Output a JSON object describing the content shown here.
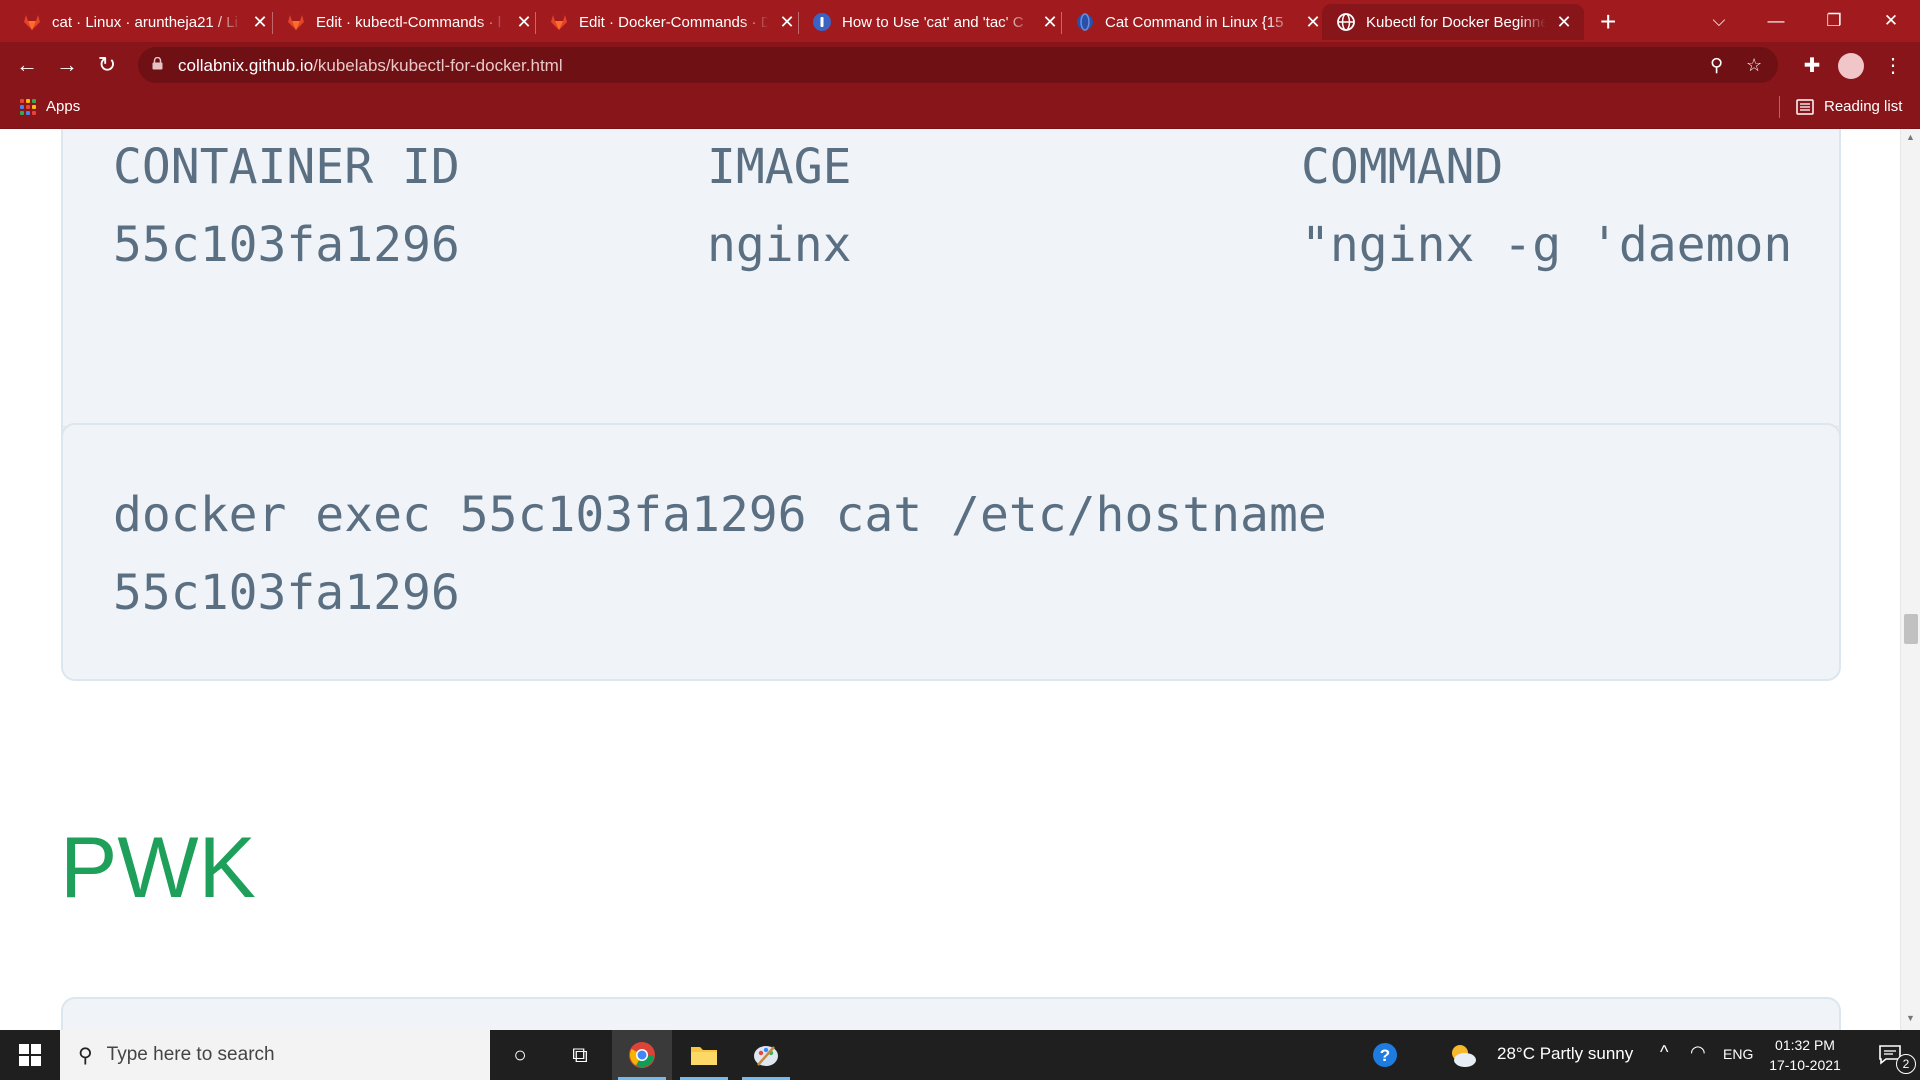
{
  "browser": {
    "tabs": [
      {
        "title": "cat · Linux · aruntheja21 / Li",
        "favicon": "gitlab-fox-icon"
      },
      {
        "title": "Edit · kubectl-Commands · l",
        "favicon": "gitlab-fox-icon"
      },
      {
        "title": "Edit · Docker-Commands · D",
        "favicon": "gitlab-fox-icon"
      },
      {
        "title": "How to Use 'cat' and 'tac' C",
        "favicon": "site-shield-icon"
      },
      {
        "title": "Cat Command in Linux {15",
        "favicon": "site-globe-blue-icon"
      },
      {
        "title": "Kubectl for Docker Beginne",
        "favicon": "globe-icon",
        "active": true
      }
    ],
    "close_glyph": "✕",
    "new_tab_glyph": "+",
    "url_host": "collabnix.github.io",
    "url_path": "/kubelabs/kubectl-for-docker.html",
    "bookmarks": {
      "apps_label": "Apps",
      "reading_list_label": "Reading list"
    },
    "accent": "#871519"
  },
  "page": {
    "docker_ps": {
      "headers": [
        "CONTAINER ID",
        "IMAGE",
        "COMMAND"
      ],
      "row": [
        "55c103fa1296",
        "nginx",
        "\"nginx -g 'daemon"
      ]
    },
    "exec_block": {
      "line1": "docker exec 55c103fa1296 cat /etc/hostname",
      "line2": "55c103fa1296"
    },
    "section_heading": "PWK",
    "heading_color": "#1ea05a"
  },
  "taskbar": {
    "search_placeholder": "Type here to search",
    "weather": "28°C  Partly sunny",
    "language": "ENG",
    "time": "01:32 PM",
    "date": "17-10-2021",
    "notifications_count": "2"
  }
}
